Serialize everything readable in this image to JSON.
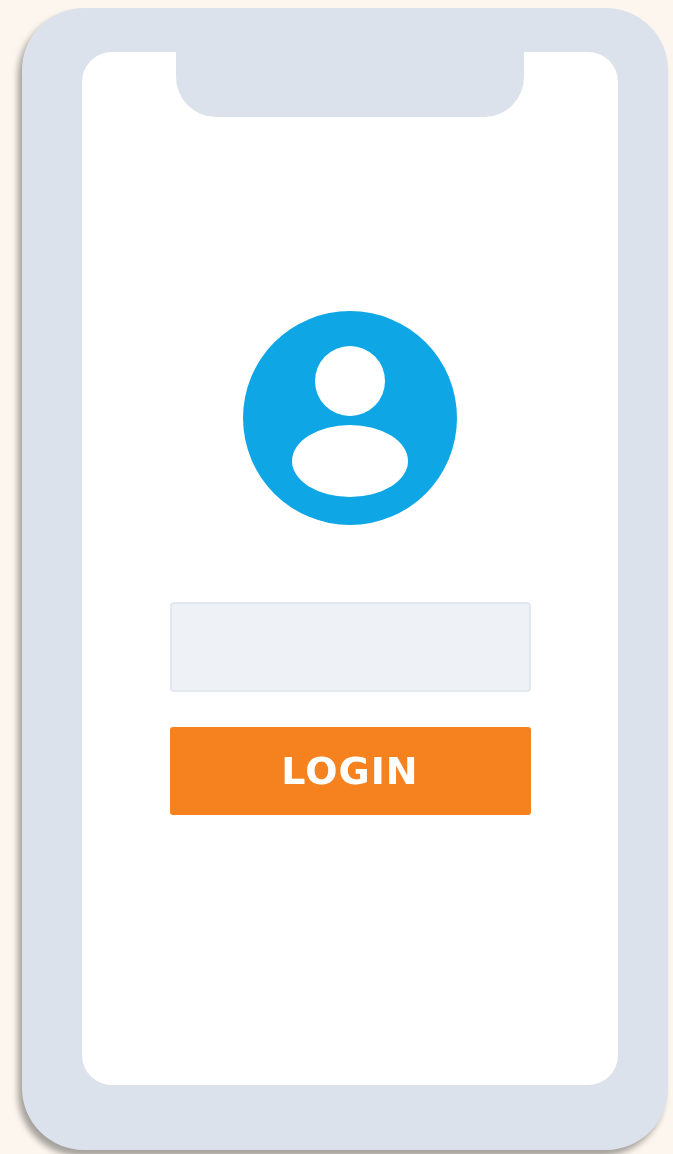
{
  "login_button": {
    "label": "LOGIN"
  }
}
